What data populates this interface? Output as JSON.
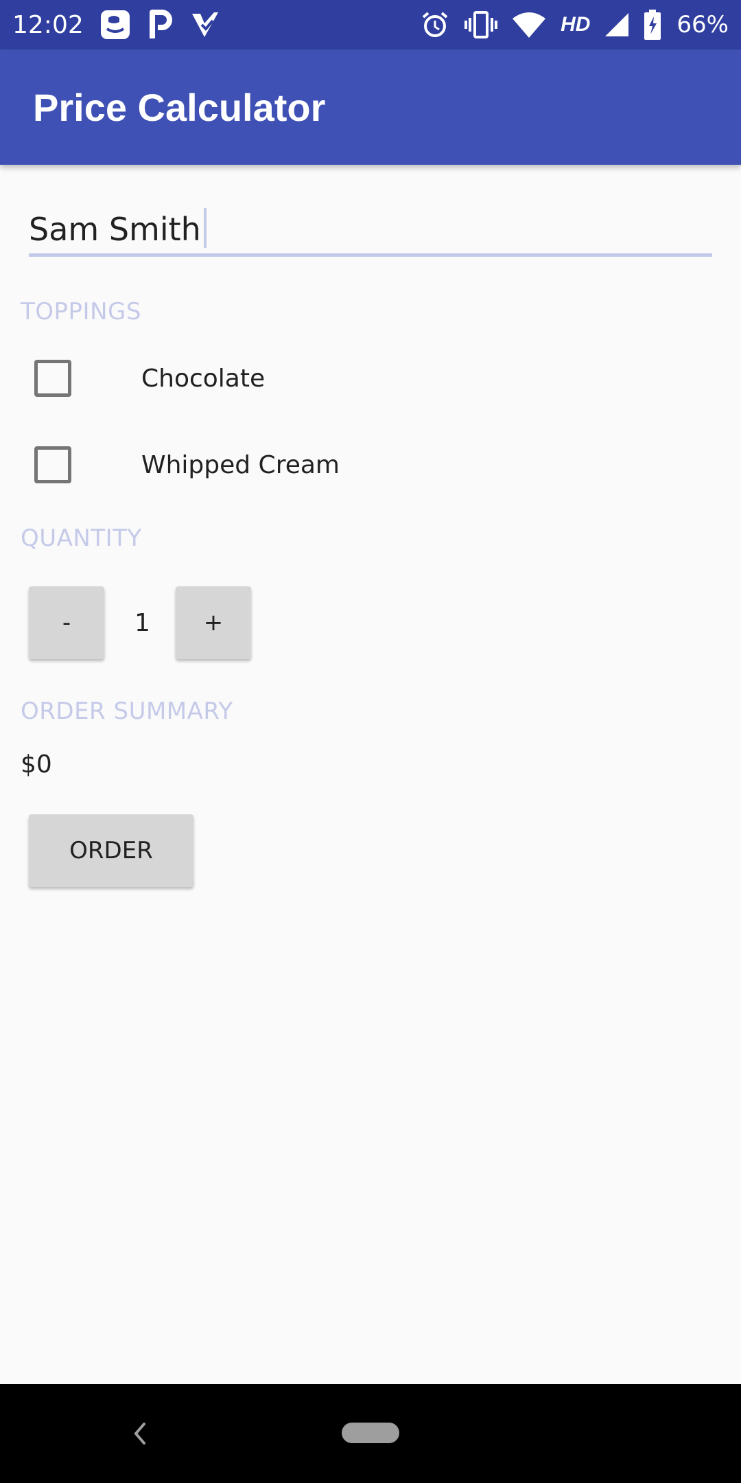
{
  "status_bar": {
    "time": "12:02",
    "network": "HD",
    "battery_percent": "66%",
    "notification_icons": [
      "gallery-icon",
      "parking-icon",
      "checkmark-app-icon"
    ],
    "system_icons": [
      "alarm-icon",
      "vibrate-icon",
      "wifi-icon",
      "signal-icon",
      "battery-charging-icon"
    ]
  },
  "app_bar": {
    "title": "Price Calculator"
  },
  "name_field": {
    "value": "Sam Smith"
  },
  "toppings": {
    "label": "TOPPINGS",
    "items": [
      {
        "label": "Chocolate",
        "checked": false
      },
      {
        "label": "Whipped Cream",
        "checked": false
      }
    ]
  },
  "quantity": {
    "label": "QUANTITY",
    "decrement_label": "-",
    "value": "1",
    "increment_label": "+"
  },
  "summary": {
    "label": "ORDER SUMMARY",
    "price": "$0"
  },
  "order_button": {
    "label": "ORDER"
  },
  "colors": {
    "status_bar": "#303f9f",
    "app_bar": "#3f51b5",
    "section_label": "#c5cae9",
    "button": "#d6d6d6"
  }
}
